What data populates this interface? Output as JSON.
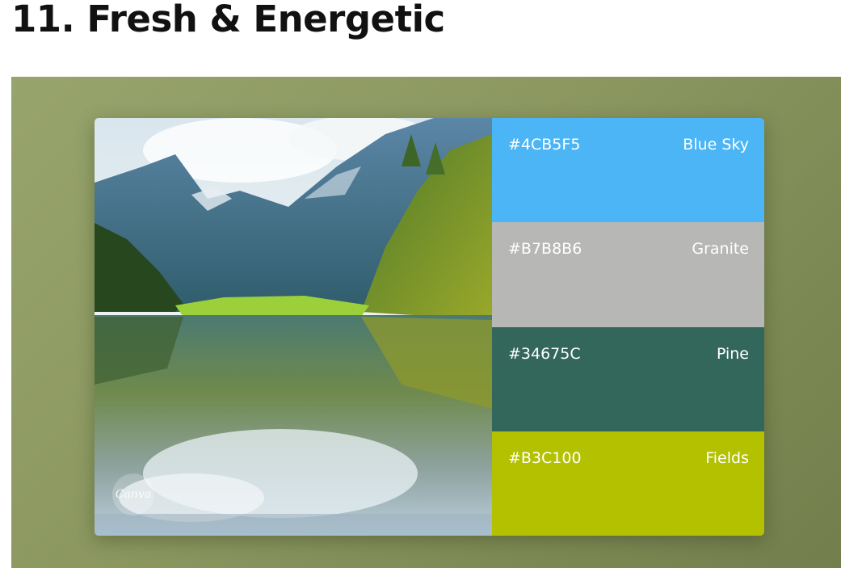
{
  "article": {
    "heading": "11. Fresh & Energetic"
  },
  "photo": {
    "description_icon": "mountain-lake-photo",
    "watermark_text": "Canva"
  },
  "palette": {
    "swatches": [
      {
        "hex": "#4CB5F5",
        "name": "Blue Sky",
        "color": "#4CB5F5"
      },
      {
        "hex": "#B7B8B6",
        "name": "Granite",
        "color": "#B7B8B6"
      },
      {
        "hex": "#34675C",
        "name": "Pine",
        "color": "#34675C"
      },
      {
        "hex": "#B3C100",
        "name": "Fields",
        "color": "#B3C100"
      }
    ]
  },
  "colors": {
    "backdrop": "#8E9A62",
    "heading_text": "#111111"
  }
}
